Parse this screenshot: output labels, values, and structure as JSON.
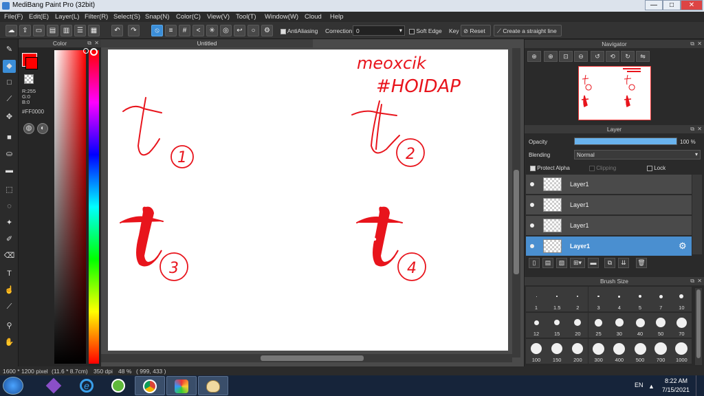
{
  "window": {
    "title": "MediBang Paint Pro (32bit)",
    "min": "—",
    "max": "□",
    "close": "✕"
  },
  "menu": [
    "File(F)",
    "Edit(E)",
    "Layer(L)",
    "Filter(R)",
    "Select(S)",
    "Snap(N)",
    "Color(C)",
    "View(V)",
    "Tool(T)",
    "Window(W)",
    "Cloud",
    "Help"
  ],
  "toolbar": {
    "antialiasing": "AntiAliasing",
    "correction_label": "Correction",
    "correction_value": "0",
    "soft_edge": "Soft Edge",
    "key": "Key",
    "reset": "Reset",
    "straight_line": "Create a straight line"
  },
  "color_panel": {
    "title": "Color",
    "r": "R:255",
    "g": "G:0",
    "b": "B:0",
    "hex": "#FF0000",
    "primary_color": "#ff0000"
  },
  "canvas": {
    "tab_title": "Untitled",
    "drawing": {
      "signature_line1": "meoxcik",
      "signature_line2": "#HOIDAP",
      "numbers": [
        "1",
        "2",
        "3",
        "4"
      ],
      "ink_color": "#e8141c"
    }
  },
  "navigator": {
    "title": "Navigator"
  },
  "layer_panel": {
    "title": "Layer",
    "opacity_label": "Opacity",
    "opacity_value": "100 %",
    "opacity_fraction": 1.0,
    "blending_label": "Blending",
    "blending_value": "Normal",
    "protect_alpha": "Protect Alpha",
    "clipping": "Clipping",
    "lock": "Lock",
    "layers": [
      {
        "name": "Layer1",
        "selected": false
      },
      {
        "name": "Layer1",
        "selected": false
      },
      {
        "name": "Layer1",
        "selected": false
      },
      {
        "name": "Layer1",
        "selected": true
      }
    ]
  },
  "brush_size": {
    "title": "Brush Size",
    "sizes": [
      "1",
      "1.5",
      "2",
      "3",
      "4",
      "5",
      "7",
      "10",
      "12",
      "15",
      "20",
      "25",
      "30",
      "40",
      "50",
      "70",
      "100",
      "150",
      "200",
      "300",
      "400",
      "500",
      "700",
      "1000"
    ]
  },
  "status": {
    "dimensions": "1600 * 1200 pixel",
    "size_cm": "(11.6 * 8.7cm)",
    "dpi": "350 dpi",
    "zoom": "48 %",
    "coords": "( 999, 433 )"
  },
  "taskbar": {
    "lang": "EN",
    "time": "8:22 AM",
    "date": "7/15/2021"
  }
}
